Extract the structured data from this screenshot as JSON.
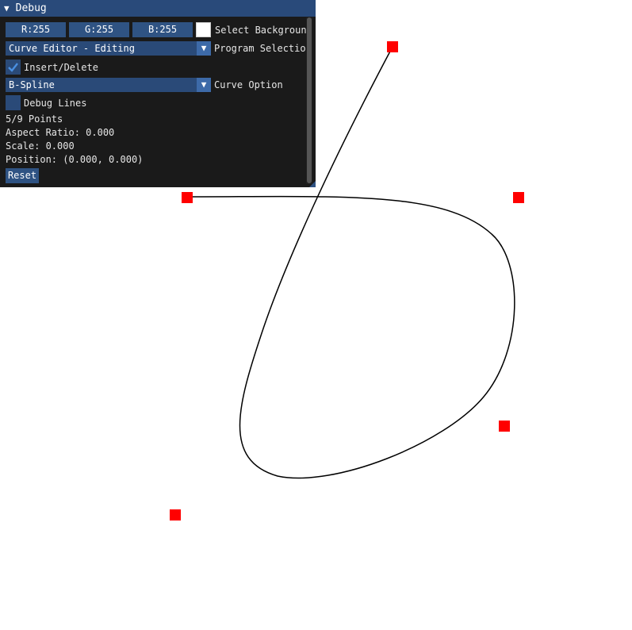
{
  "window": {
    "title": "Debug",
    "collapse_icon": "triangle-down-icon"
  },
  "color_buttons": {
    "r_label": "R:255",
    "g_label": "G:255",
    "b_label": "B:255",
    "swatch_color": "#ffffff",
    "select_background_label": "Select Backgroun"
  },
  "program_selection": {
    "value": "Curve Editor - Editing",
    "label": "Program Selectio"
  },
  "insert_delete": {
    "label": "Insert/Delete",
    "checked": true
  },
  "curve_option": {
    "value": "B-Spline",
    "label": "Curve Option"
  },
  "debug_lines": {
    "label": "Debug Lines",
    "checked": false
  },
  "stats": {
    "points": "5/9 Points",
    "aspect_ratio": "Aspect Ratio: 0.000",
    "scale": "Scale: 0.000",
    "position": "Position: (0.000, 0.000)"
  },
  "reset_label": "Reset",
  "colors": {
    "accent": "#2f5383",
    "frame": "#2a4a78",
    "title_bar": "#294a7a",
    "window_bg": "#1a1a1a",
    "control_point": "#ff0000",
    "curve": "#000000"
  }
}
